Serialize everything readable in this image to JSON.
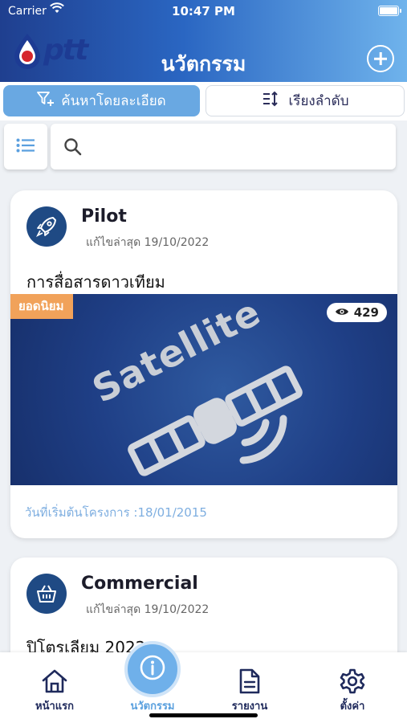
{
  "status_bar": {
    "carrier": "Carrier",
    "time": "10:47 PM"
  },
  "header": {
    "logo_text": "ptt",
    "title": "นวัตกรรม"
  },
  "toolbar": {
    "filter_label": "ค้นหาโดยละเอียด",
    "sort_label": "เรียงลำดับ"
  },
  "search": {
    "value": "",
    "placeholder": ""
  },
  "cards": [
    {
      "stage": "Pilot",
      "updated": "แก้ไขล่าสุด 19/10/2022",
      "project": "การสื่อสารดาวเทียม",
      "badge": "ยอดนิยม",
      "views": "429",
      "image_text": "Satellite",
      "start_date": "วันที่เริ่มต้นโครงการ :18/01/2015",
      "icon": "rocket-icon"
    },
    {
      "stage": "Commercial",
      "updated": "แก้ไขล่าสุด 19/10/2022",
      "project": "ปิโตรเลียม 2022",
      "icon": "basket-icon"
    }
  ],
  "bottom_nav": {
    "home": "หน้าแรก",
    "innovation": "นวัตกรรม",
    "report": "รายงาน",
    "settings": "ตั้งค่า"
  },
  "colors": {
    "header_start": "#1f3f8f",
    "header_end": "#6fb3ec",
    "accent": "#69a8e2",
    "badge": "#f1a25a",
    "navy": "#1f2a5c"
  }
}
